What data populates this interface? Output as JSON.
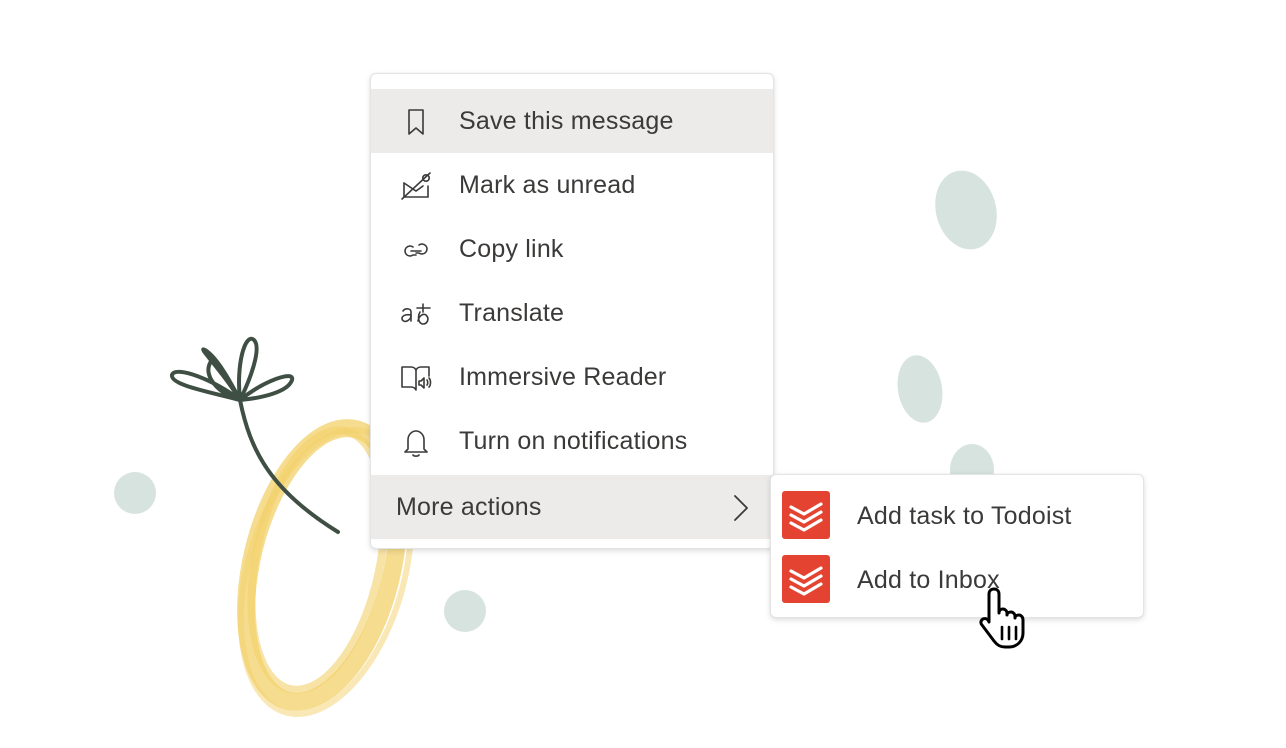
{
  "menu": {
    "items": [
      {
        "label": "Save this message",
        "icon": "bookmark-icon",
        "highlighted": true
      },
      {
        "label": "Mark as unread",
        "icon": "mark-unread-icon"
      },
      {
        "label": "Copy link",
        "icon": "link-icon"
      },
      {
        "label": "Translate",
        "icon": "translate-icon"
      },
      {
        "label": "Immersive Reader",
        "icon": "immersive-reader-icon"
      },
      {
        "label": "Turn on notifications",
        "icon": "bell-icon"
      }
    ],
    "more_actions": {
      "label": "More actions",
      "icon": "chevron-right-icon"
    }
  },
  "submenu": {
    "items": [
      {
        "label": "Add task to Todoist",
        "icon": "todoist-icon"
      },
      {
        "label": "Add to Inbox",
        "icon": "todoist-icon"
      }
    ]
  },
  "colors": {
    "todoist_brand": "#e44332",
    "highlight": "#edebe9",
    "text": "#3b3a39"
  }
}
